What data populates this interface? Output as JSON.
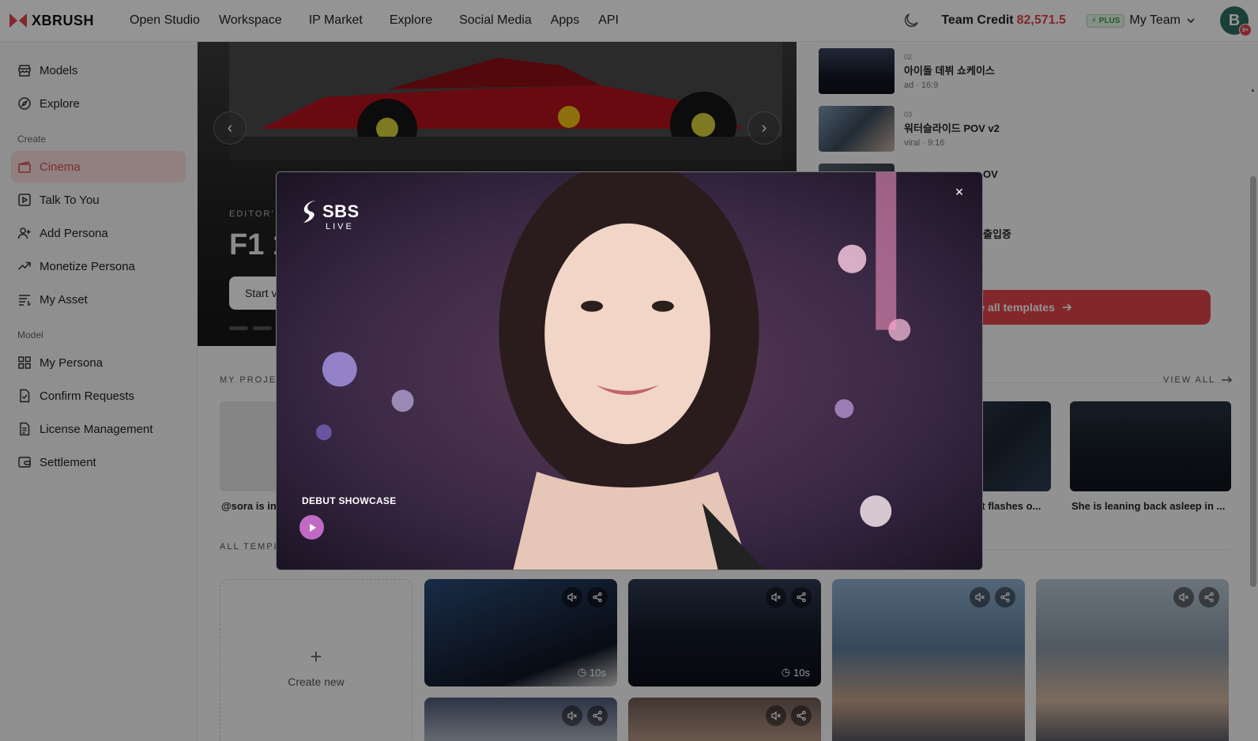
{
  "header": {
    "brand": "XBRUSH",
    "nav": [
      "Open Studio",
      "Workspace",
      "IP Market",
      "Explore",
      "Social Media",
      "Apps",
      "API"
    ],
    "credit_label": "Team Credit",
    "credit_value": "82,571.5",
    "plan_badge": "PLUS",
    "team_name": "My Team",
    "avatar_initial": "B",
    "avatar_badge": "9+",
    "brand_color": "#e0454b"
  },
  "sidebar": {
    "top_items": [
      {
        "label": "Models",
        "icon": "store-icon"
      },
      {
        "label": "Explore",
        "icon": "compass-icon"
      }
    ],
    "create_section": "Create",
    "create_items": [
      {
        "label": "Cinema",
        "icon": "clapperboard-icon",
        "active": true
      },
      {
        "label": "Talk To You",
        "icon": "play-square-icon"
      },
      {
        "label": "Add Persona",
        "icon": "user-plus-icon"
      },
      {
        "label": "Monetize Persona",
        "icon": "trending-up-icon"
      },
      {
        "label": "My Asset",
        "icon": "list-icon"
      }
    ],
    "model_section": "Model",
    "model_items": [
      {
        "label": "My Persona",
        "icon": "grid-icon"
      },
      {
        "label": "Confirm Requests",
        "icon": "file-check-icon"
      },
      {
        "label": "License Management",
        "icon": "file-text-icon"
      },
      {
        "label": "Settlement",
        "icon": "wallet-icon"
      }
    ]
  },
  "hero": {
    "kicker": "EDITOR'",
    "title": "F1 1",
    "button": "Start v"
  },
  "templates_side": [
    {
      "num": "02",
      "name": "아이돌 데뷔 쇼케이스",
      "meta": "ad · 16:9"
    },
    {
      "num": "03",
      "name": "워터슬라이드 POV v2",
      "meta": "viral · 9:16"
    },
    {
      "num": "",
      "name": "OV",
      "meta": ""
    },
    {
      "num": "",
      "name": "출입증",
      "meta": ""
    }
  ],
  "browse_label": "owse all templates",
  "projects": {
    "label": "MY PROJEC",
    "view_all": "VIEW ALL",
    "captions": [
      "@sora is int",
      "ert flashes o...",
      "She is leaning back asleep in ..."
    ]
  },
  "all_templates": {
    "label": "ALL TEMPL",
    "create_new": "Create new",
    "durations": [
      "10s",
      "10s"
    ]
  },
  "modal": {
    "logo_main": "SBS",
    "logo_sub": "LIVE",
    "caption": "DEBUT SHOWCASE",
    "close_symbol": "×"
  }
}
